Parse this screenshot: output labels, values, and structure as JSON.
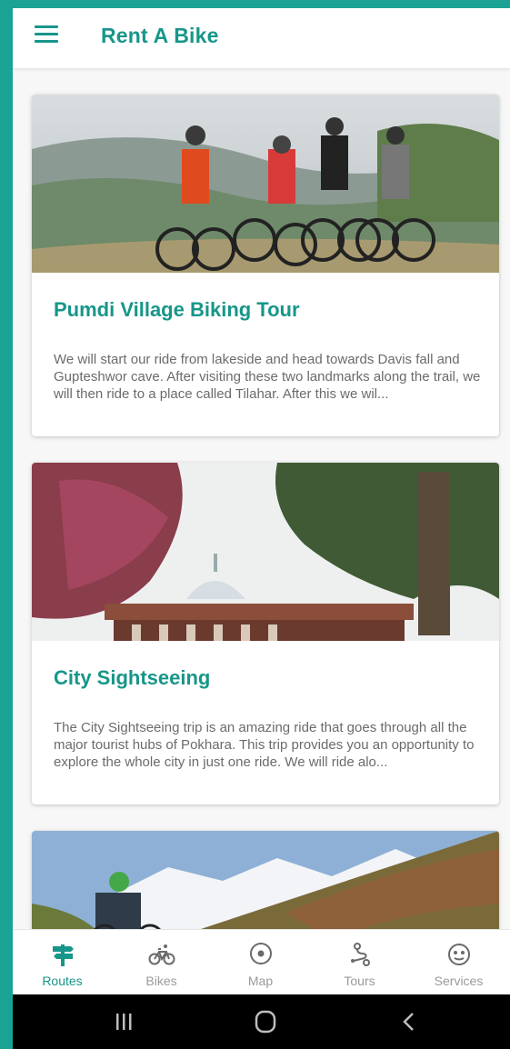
{
  "app": {
    "title": "Rent A Bike"
  },
  "colors": {
    "brand": "#17968a",
    "frame": "#1aa394",
    "muted": "#9a9a9a"
  },
  "tours": [
    {
      "title": "Pumdi Village Biking Tour",
      "description": "We will start our ride from lakeside and head towards Davis fall and Gupteshwor cave. After visiting these two landmarks along the trail, we will then ride to a place called Tilahar. After this we wil..."
    },
    {
      "title": "City Sightseeing",
      "description": "The City Sightseeing trip is an amazing ride that goes through all the major tourist hubs of Pokhara. This trip provides you an opportunity to explore the whole city in just one ride. We will ride alo..."
    }
  ],
  "nav": {
    "items": [
      {
        "label": "Routes",
        "icon": "signpost-icon",
        "active": true
      },
      {
        "label": "Bikes",
        "icon": "bicycle-icon",
        "active": false
      },
      {
        "label": "Map",
        "icon": "map-pin-icon",
        "active": false
      },
      {
        "label": "Tours",
        "icon": "route-icon",
        "active": false
      },
      {
        "label": "Services",
        "icon": "services-icon",
        "active": false
      }
    ]
  },
  "system_nav": {
    "icons": [
      "recent-apps-icon",
      "home-icon",
      "back-icon"
    ]
  }
}
